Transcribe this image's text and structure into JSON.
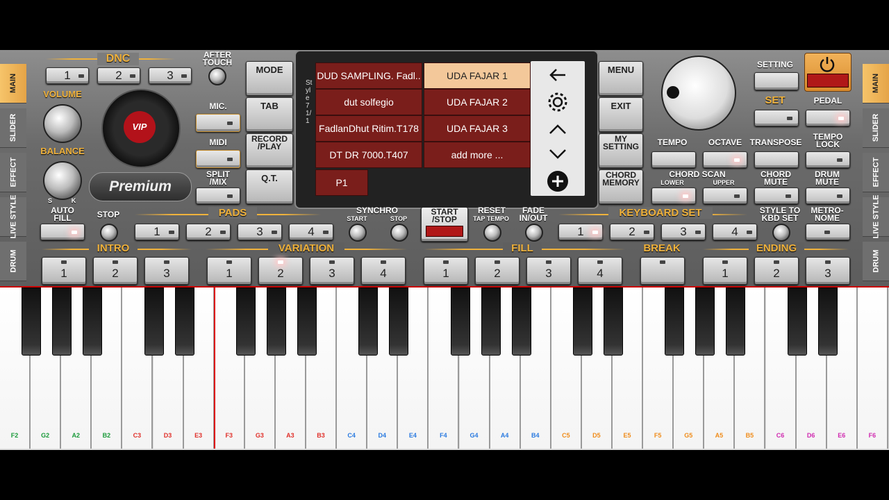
{
  "sidebar_left": [
    {
      "label": "MAIN",
      "active": true
    },
    {
      "label": "SLIDER",
      "active": false
    },
    {
      "label": "EFFECT",
      "active": false
    },
    {
      "label": "LIVE STYLE",
      "active": false
    },
    {
      "label": "DRUM",
      "active": false
    }
  ],
  "sidebar_right": [
    {
      "label": "MAIN",
      "active": true
    },
    {
      "label": "SLIDER",
      "active": false
    },
    {
      "label": "EFFECT",
      "active": false
    },
    {
      "label": "LIVE STYLE",
      "active": false
    },
    {
      "label": "DRUM",
      "active": false
    }
  ],
  "top": {
    "dnc": "DNC",
    "dnc_buttons": [
      "1",
      "2",
      "3"
    ],
    "after_touch": "AFTER\nTOUCH",
    "volume": "VOLUME",
    "balance": "BALANCE",
    "balance_s": "S",
    "balance_k": "K",
    "logo_text": "VIP",
    "premium": "Premium",
    "mic": "MIC.",
    "midi": "MIDI",
    "split_mix": "SPLIT\n/MIX",
    "mode": "MODE",
    "tab": "TAB",
    "record_play": "RECORD\n/PLAY",
    "qt": "Q.T.",
    "menu": "MENU",
    "exit": "EXIT",
    "my_setting": "MY\nSETTING",
    "chord_memory": "CHORD\nMEMORY",
    "setting": "SETTING",
    "set": "SET",
    "pedal": "PEDAL",
    "tempo": "TEMPO",
    "octave": "OCTAVE",
    "transpose": "TRANSPOSE",
    "tempo_lock": "TEMPO\nLOCK",
    "chord_scan": "CHORD SCAN",
    "lower": "LOWER",
    "upper": "UPPER",
    "chord_mute": "CHORD\nMUTE",
    "drum_mute": "DRUM\nMUTE"
  },
  "screen": {
    "side_label": "Style 7 1/1",
    "left_cells": [
      "DUD SAMPLING. Fadl..",
      "dut solfegio",
      "FadlanDhut Ritim.T178",
      "DT DR 7000.T407",
      "P1"
    ],
    "right_cells": [
      "UDA FAJAR 1",
      "UDA FAJAR 2",
      "UDA FAJAR 3",
      "add more ..."
    ]
  },
  "row2": {
    "auto_fill": "AUTO\nFILL",
    "stop": "STOP",
    "pads": "PADS",
    "pad_buttons": [
      "1",
      "2",
      "3",
      "4"
    ],
    "synchro": "SYNCHRO",
    "synchro_start": "START",
    "synchro_stop": "STOP",
    "start_stop": "START\n/STOP",
    "reset": "RESET",
    "tap_tempo": "TAP TEMPO",
    "fade": "FADE\nIN/OUT",
    "keyboard_set": "KEYBOARD SET",
    "kbd_buttons": [
      "1",
      "2",
      "3",
      "4"
    ],
    "style_to_kbd": "STYLE TO\nKBD SET",
    "metronome": "METRO-\nNOME"
  },
  "row3": {
    "intro": "INTRO",
    "intro_buttons": [
      "1",
      "2",
      "3"
    ],
    "variation": "VARIATION",
    "variation_buttons": [
      "1",
      "2",
      "3",
      "4"
    ],
    "fill": "FILL",
    "fill_buttons": [
      "1",
      "2",
      "3",
      "4"
    ],
    "break": "BREAK",
    "ending": "ENDING",
    "ending_buttons": [
      "1",
      "2",
      "3"
    ]
  },
  "keys": {
    "notes": [
      "F2",
      "G2",
      "A2",
      "B2",
      "C3",
      "D3",
      "E3",
      "F3",
      "G3",
      "A3",
      "B3",
      "C4",
      "D4",
      "E4",
      "F4",
      "G4",
      "A4",
      "B4",
      "C5",
      "D5",
      "E5",
      "F5",
      "G5",
      "A5",
      "B5",
      "C6",
      "D6",
      "E6",
      "F6"
    ],
    "colors": [
      "#1a9a3a",
      "#1a9a3a",
      "#1a9a3a",
      "#1a9a3a",
      "#e0302a",
      "#e0302a",
      "#e0302a",
      "#e0302a",
      "#e0302a",
      "#e0302a",
      "#e0302a",
      "#2a7ae0",
      "#2a7ae0",
      "#2a7ae0",
      "#2a7ae0",
      "#2a7ae0",
      "#2a7ae0",
      "#2a7ae0",
      "#f08c1a",
      "#f08c1a",
      "#f08c1a",
      "#f08c1a",
      "#f08c1a",
      "#f08c1a",
      "#f08c1a",
      "#d02ab0",
      "#d02ab0",
      "#d02ab0",
      "#d02ab0"
    ]
  },
  "colors": {
    "accent": "#f0b23c",
    "display_cell": "#7a1e1b",
    "selected_cell": "#f3c89a"
  }
}
